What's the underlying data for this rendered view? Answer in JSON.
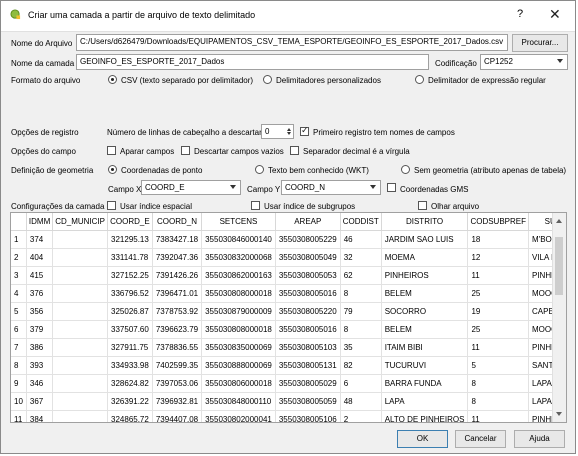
{
  "window": {
    "title": "Criar uma camada a partir de arquivo de texto delimitado",
    "help": "?",
    "close": "✕"
  },
  "file": {
    "label": "Nome do Arquivo",
    "value": "C:/Users/d626479/Downloads/EQUIPAMENTOS_CSV_TEMA_ESPORTE/GEOINFO_ES_ESPORTE_2017_Dados.csv",
    "browse": "Procurar..."
  },
  "layer": {
    "label": "Nome da camada",
    "value": "GEOINFO_ES_ESPORTE_2017_Dados",
    "encoding_label": "Codificação",
    "encoding": "CP1252"
  },
  "format": {
    "label": "Formato do arquivo",
    "csv": "CSV (texto separado por delimitador)",
    "custom": "Delimitadores personalizados",
    "regex": "Delimitador de expressão regular"
  },
  "record": {
    "label": "Opções de registro",
    "header_lines_label": "Número de linhas de cabeçalho a descartar",
    "header_lines": "0",
    "first_record_names": "Primeiro registro tem nomes de campos"
  },
  "field_options": {
    "label": "Opções do campo",
    "trim": "Aparar campos",
    "discard_empty": "Descartar campos vazios",
    "decimal_comma": "Separador decimal é a vírgula"
  },
  "geometry": {
    "label": "Definição de geometria",
    "point": "Coordenadas de ponto",
    "wkt": "Texto bem conhecido (WKT)",
    "none": "Sem geometria (atributo apenas de tabela)",
    "x_label": "Campo X",
    "x_value": "COORD_E",
    "y_label": "Campo Y",
    "y_value": "COORD_N",
    "dms": "Coordenadas GMS"
  },
  "layer_settings": {
    "label": "Configurações da camada",
    "spatial_index": "Usar índice espacial",
    "subset_index": "Usar índice de subgrupos",
    "watch_file": "Olhar arquivo"
  },
  "table": {
    "columns": [
      "IDMM",
      "CD_MUNICIP",
      "COORD_E",
      "COORD_N",
      "SETCENS",
      "AREAP",
      "CODDIST",
      "DISTRITO",
      "CODSUBPREF",
      "SUBPR"
    ],
    "rows": [
      [
        "1",
        "374",
        "",
        "321295.13",
        "7383427.18",
        "355030846000140",
        "3550308005229",
        "46",
        "JARDIM SAO LUIS",
        "18",
        "M'BOI MIRIM"
      ],
      [
        "2",
        "404",
        "",
        "331141.78",
        "7392047.36",
        "355030832000068",
        "3550308005049",
        "32",
        "MOEMA",
        "12",
        "VILA MARIAN"
      ],
      [
        "3",
        "415",
        "",
        "327152.25",
        "7391426.26",
        "355030862000163",
        "3550308005053",
        "62",
        "PINHEIROS",
        "11",
        "PINHEIROS"
      ],
      [
        "4",
        "376",
        "",
        "336796.52",
        "7396471.01",
        "355030808000018",
        "3550308005016",
        "8",
        "BELEM",
        "25",
        "MOOCA"
      ],
      [
        "5",
        "356",
        "",
        "325026.87",
        "7378753.92",
        "355030879000009",
        "3550308005220",
        "79",
        "SOCORRO",
        "19",
        "CAPELA DO S"
      ],
      [
        "6",
        "379",
        "",
        "337507.60",
        "7396623.79",
        "355030808000018",
        "3550308005016",
        "8",
        "BELEM",
        "25",
        "MOOCA"
      ],
      [
        "7",
        "386",
        "",
        "327911.75",
        "7378836.55",
        "355030835000069",
        "3550308005103",
        "35",
        "ITAIM BIBI",
        "11",
        "PINHEIROS"
      ],
      [
        "8",
        "393",
        "",
        "334933.98",
        "7402599.35",
        "355030888000069",
        "3550308005131",
        "82",
        "TUCURUVI",
        "5",
        "SANTANA-TU"
      ],
      [
        "9",
        "346",
        "",
        "328624.82",
        "7397053.06",
        "355030806000018",
        "3550308005029",
        "6",
        "BARRA FUNDA",
        "8",
        "LAPA"
      ],
      [
        "10",
        "367",
        "",
        "326391.22",
        "7396932.81",
        "355030848000110",
        "3550308005059",
        "48",
        "LAPA",
        "8",
        "LAPA"
      ],
      [
        "11",
        "384",
        "",
        "324865.72",
        "7394407.08",
        "355030802000041",
        "3550308005106",
        "2",
        "ALTO DE PINHEIROS",
        "11",
        "PINHEIROS"
      ]
    ]
  },
  "footer": {
    "ok": "OK",
    "cancel": "Cancelar",
    "help": "Ajuda"
  }
}
